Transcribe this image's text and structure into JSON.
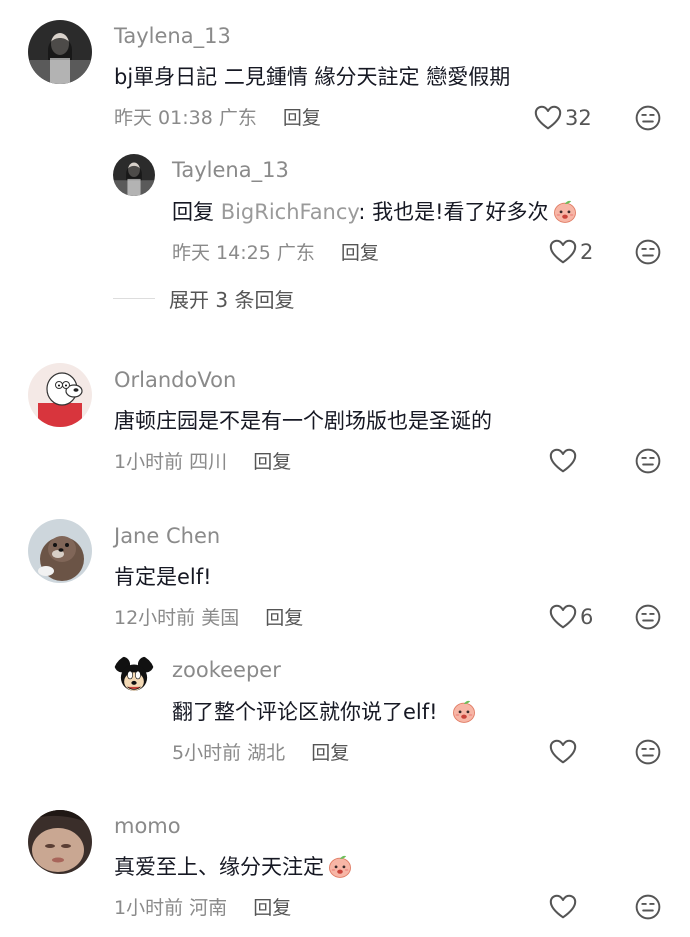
{
  "comments": [
    {
      "username": "Taylena_13",
      "text": "bj單身日記 二見鍾情 緣分天註定 戀愛假期",
      "time": "昨天 01:38",
      "location": "广东",
      "reply_label": "回复",
      "likes": "32",
      "reply": {
        "username": "Taylena_13",
        "reply_prefix": "回复",
        "reply_to": "BigRichFancy",
        "text": ": 我也是!看了好多次",
        "time": "昨天 14:25",
        "location": "广东",
        "reply_label": "回复",
        "likes": "2"
      },
      "expand_label": "展开 3 条回复"
    },
    {
      "username": "OrlandoVon",
      "text": "唐顿庄园是不是有一个剧场版也是圣诞的",
      "time": "1小时前",
      "location": "四川",
      "reply_label": "回复",
      "likes": ""
    },
    {
      "username": "Jane Chen",
      "text": "肯定是elf!",
      "time": "12小时前",
      "location": "美国",
      "reply_label": "回复",
      "likes": "6",
      "reply": {
        "username": "zookeeper",
        "text": "翻了整个评论区就你说了elf!",
        "time": "5小时前",
        "location": "湖北",
        "reply_label": "回复",
        "likes": ""
      }
    },
    {
      "username": "momo",
      "text": "真爱至上、缘分天注定",
      "time": "1小时前",
      "location": "河南",
      "reply_label": "回复",
      "likes": ""
    }
  ],
  "icons": {
    "like": "heart-outline-icon",
    "dislike": "frown-face-icon",
    "emoji": "peach-emoji-icon"
  },
  "colors": {
    "username": "#8a8a8a",
    "text": "#161823",
    "meta": "#8a8a8a",
    "icon": "#555555"
  }
}
